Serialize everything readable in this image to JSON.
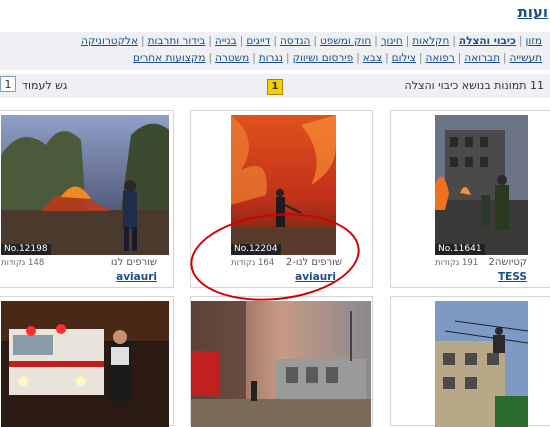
{
  "page": {
    "title": "ועות"
  },
  "categories": {
    "row1": [
      "אלקטרוניקה",
      "בידור ותרבות",
      "בנייה",
      "דייגים",
      "הנדסה",
      "חוק ומשפט",
      "חינוך",
      "חקלאות",
      "כיבוי והצלה",
      "מזון"
    ],
    "row2": [
      "מקצועות אחרים",
      "משטרה",
      "נגרות",
      "פירסום ושיווק",
      "צבא",
      "צילום",
      "רפואה",
      "תברואה",
      "תעשייה"
    ],
    "active": "כיבוי והצלה"
  },
  "pager": {
    "count_text": "11 תמונות בנושא כיבוי והצלה",
    "current_page": "1",
    "goto_label": "גש לעמוד",
    "goto_value": "1"
  },
  "cards": [
    {
      "badge": "No.12198",
      "title": "שורפים לנו",
      "points": "148 נקודות",
      "user": "aviauri"
    },
    {
      "badge": "No.12204",
      "title": "שורפים לנו-2",
      "points": "164 נקודות",
      "user": "aviauri"
    },
    {
      "badge": "No.11641",
      "title": "קטיושה2",
      "points": "191 נקודות",
      "user": "TESS"
    }
  ],
  "colors": {
    "link": "#1a4f8a",
    "bar_bg": "#eef0f4",
    "highlight": "#f5d000",
    "annotation": "#d00000"
  }
}
